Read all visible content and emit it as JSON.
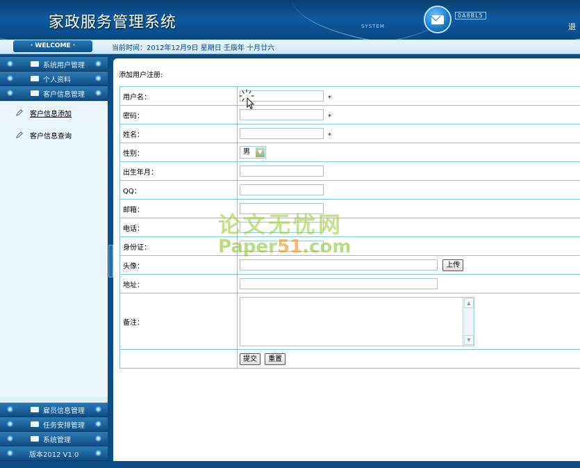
{
  "header": {
    "title": "家政服务管理系统",
    "system_label": "SYSTEM",
    "brand_text": "0A8BL5",
    "exit_label": "退"
  },
  "welcome_bar": {
    "badge": "· WELCOME ·",
    "current_time": "当前时间：2012年12月9日 星期日 壬辰年 十月廿六"
  },
  "sidebar": {
    "top_menus": [
      {
        "label": "系统用户管理"
      },
      {
        "label": "个人资料"
      },
      {
        "label": "客户信息管理"
      }
    ],
    "submenu_items": [
      {
        "label": "客户信息添加",
        "active": true
      },
      {
        "label": "客户信息查询",
        "active": false
      }
    ],
    "bottom_menus": [
      {
        "label": "雇员信息管理"
      },
      {
        "label": "任务安排管理"
      },
      {
        "label": "系统管理"
      }
    ],
    "version": "版本2012 V1.0"
  },
  "form": {
    "title": "添加用户注册:",
    "fields": {
      "username": {
        "label": "用户名：",
        "value": "",
        "required": "*"
      },
      "password": {
        "label": "密码：",
        "value": "",
        "required": "*"
      },
      "name": {
        "label": "姓名：",
        "value": "",
        "required": "*"
      },
      "gender": {
        "label": "性别：",
        "value": "男"
      },
      "birth": {
        "label": "出生年月：",
        "value": ""
      },
      "qq": {
        "label": "QQ：",
        "value": ""
      },
      "email": {
        "label": "邮箱：",
        "value": ""
      },
      "phone": {
        "label": "电话：",
        "value": ""
      },
      "id_card": {
        "label": "身份证：",
        "value": ""
      },
      "avatar": {
        "label": "头像：",
        "value": "",
        "upload_label": "上传"
      },
      "address": {
        "label": "地址：",
        "value": ""
      },
      "notes": {
        "label": "备注：",
        "value": ""
      }
    },
    "submit_label": "提交",
    "reset_label": "重置"
  },
  "watermark": {
    "cn": "论文无忧网",
    "en_prefix": "Paper",
    "en_highlight": "51",
    "en_suffix": ".com"
  },
  "colors": {
    "header_blue": "#0f5aa0",
    "sidebar_bg": "#dff0f7",
    "table_border": "#7fc6d3"
  }
}
